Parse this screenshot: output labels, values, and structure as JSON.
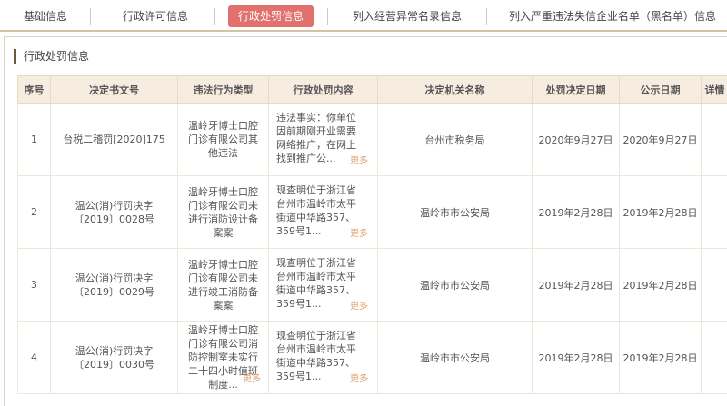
{
  "tabs": [
    {
      "label": "基础信息"
    },
    {
      "label": "行政许可信息"
    },
    {
      "label": "行政处罚信息"
    },
    {
      "label": "列入经营异常名录信息"
    },
    {
      "label": "列入严重违法失信企业名单（黑名单）信息"
    }
  ],
  "section_title": "行政处罚信息",
  "table": {
    "headers": [
      "序号",
      "决定书文号",
      "违法行为类型",
      "行政处罚内容",
      "决定机关名称",
      "处罚决定日期",
      "公示日期",
      "详情"
    ],
    "rows": [
      {
        "no": "1",
        "doc": "台税二稽罚[2020]175",
        "type": "温岭牙博士口腔门诊有限公司其他违法",
        "type_more": "",
        "content": "违法事实：你单位因前期刚开业需要网络推广，在网上找到推广公...",
        "more": "更多",
        "authority": "台州市税务局",
        "decision_date": "2020年9月27日",
        "publish_date": "2020年9月27日",
        "detail": ""
      },
      {
        "no": "2",
        "doc": "温公(消)行罚决字〔2019〕0028号",
        "type": "温岭牙博士口腔门诊有限公司未进行消防设计备案案",
        "type_more": "",
        "content": "现查明位于浙江省台州市温岭市太平街道中华路357、359号1...",
        "more": "更多",
        "authority": "温岭市市公安局",
        "decision_date": "2019年2月28日",
        "publish_date": "2019年2月28日",
        "detail": ""
      },
      {
        "no": "3",
        "doc": "温公(消)行罚决字〔2019〕0029号",
        "type": "温岭牙博士口腔门诊有限公司未进行竣工消防备案案",
        "type_more": "",
        "content": "现查明位于浙江省台州市温岭市太平街道中华路357、359号1...",
        "more": "更多",
        "authority": "温岭市市公安局",
        "decision_date": "2019年2月28日",
        "publish_date": "2019年2月28日",
        "detail": ""
      },
      {
        "no": "4",
        "doc": "温公(消)行罚决字〔2019〕0030号",
        "type": "温岭牙博士口腔门诊有限公司消防控制室未实行二十四小时值班制度...",
        "type_more": "更多",
        "content": "现查明位于浙江省台州市温岭市太平街道中华路357、359号1...",
        "more": "更多",
        "authority": "温岭市市公安局",
        "decision_date": "2019年2月28日",
        "publish_date": "2019年2月28日",
        "detail": ""
      }
    ]
  },
  "colors": {
    "active_tab": "#e2706d",
    "header_bg": "#f7ece0",
    "more_link": "#e0a070"
  }
}
